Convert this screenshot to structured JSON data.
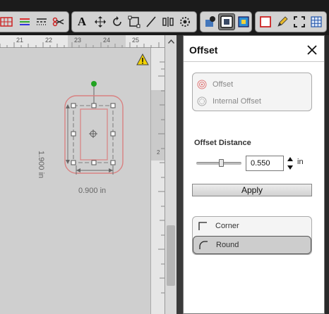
{
  "toolbar": {
    "colors": {
      "background": "#1b1b1b",
      "group": "#d2d2d2"
    },
    "groups": [
      {
        "name": "view-tools",
        "buttons": [
          "grid-mat-icon",
          "color-lines-icon",
          "line-style-icon",
          "knife-icon"
        ]
      },
      {
        "name": "edit-tools",
        "buttons": [
          "text-tool-icon",
          "move-icon",
          "rotate-icon",
          "transform-icon",
          "line-tool-icon",
          "align-icon",
          "settings-wheel-icon"
        ]
      },
      {
        "name": "effect-tools",
        "buttons": [
          "shadow-icon",
          "offset-icon",
          "fill-icon"
        ]
      },
      {
        "name": "page-tools",
        "buttons": [
          "page-frame-icon",
          "pencil-icon",
          "fullscreen-icon",
          "grid-icon"
        ]
      }
    ],
    "text_tool_glyph": "A"
  },
  "canvas": {
    "ruler_labels": [
      "21",
      "22",
      "23",
      "24",
      "25"
    ],
    "shape_width_label": "0.900 in",
    "shape_height_label": "1.900 in",
    "vertical_ruler_label": "2",
    "colors": {
      "mat": "#cfcfcf",
      "offset_outline": "#d98080",
      "handle_green": "#22a322"
    }
  },
  "panel": {
    "title": "Offset",
    "close_glyph": "✕",
    "offset_types": [
      {
        "label": "Offset",
        "icon": "offset-outer-icon"
      },
      {
        "label": "Internal Offset",
        "icon": "offset-inner-icon"
      }
    ],
    "distance": {
      "label": "Offset Distance",
      "value": "0.550",
      "unit": "in",
      "slider_fraction": 0.55
    },
    "apply_label": "Apply",
    "corner_options": [
      {
        "label": "Corner",
        "icon": "corner-sharp-icon",
        "selected": false
      },
      {
        "label": "Round",
        "icon": "corner-round-icon",
        "selected": true
      }
    ]
  }
}
